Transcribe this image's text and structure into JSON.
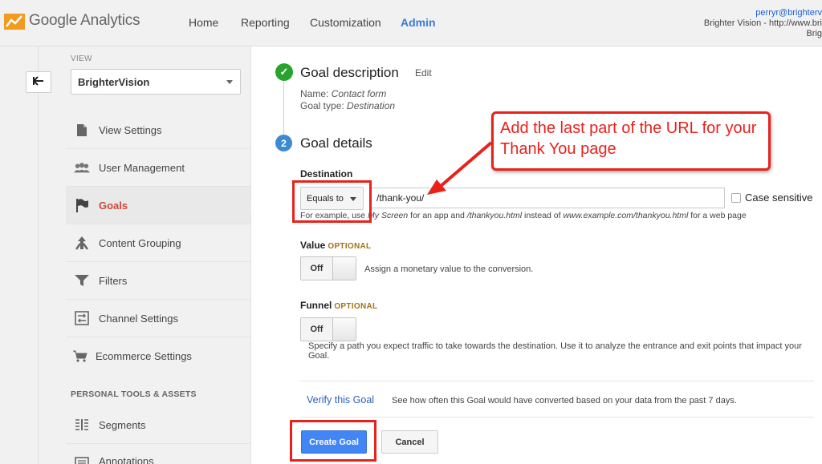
{
  "app": {
    "brand": "Google Analytics"
  },
  "nav": {
    "home": "Home",
    "reporting": "Reporting",
    "customization": "Customization",
    "admin": "Admin"
  },
  "user": {
    "email": "perryr@brighterv",
    "site": "Brighter Vision - http://www.bri",
    "site2": "Brig"
  },
  "sidebar": {
    "view_label": "VIEW",
    "view_name": "BrighterVision",
    "items": [
      {
        "label": "View Settings",
        "icon": "document-icon"
      },
      {
        "label": "User Management",
        "icon": "users-icon"
      },
      {
        "label": "Goals",
        "icon": "flag-icon"
      },
      {
        "label": "Content Grouping",
        "icon": "grouping-icon"
      },
      {
        "label": "Filters",
        "icon": "filter-icon"
      },
      {
        "label": "Channel Settings",
        "icon": "channel-icon"
      },
      {
        "label": "Ecommerce Settings",
        "icon": "cart-icon"
      }
    ],
    "section_title": "PERSONAL TOOLS & ASSETS",
    "items2": [
      {
        "label": "Segments",
        "icon": "segments-icon"
      },
      {
        "label": "Annotations",
        "icon": "annotations-icon"
      }
    ]
  },
  "goal_description": {
    "title": "Goal description",
    "edit": "Edit",
    "name_label": "Name: ",
    "name_value": "Contact form",
    "type_label": "Goal type: ",
    "type_value": "Destination"
  },
  "goal_details": {
    "step": "2",
    "title": "Goal details",
    "destination_label": "Destination",
    "match_type": "Equals to",
    "url_value": "/thank-you/",
    "case_sensitive": "Case sensitive",
    "hint_prefix": "For example, use ",
    "hint_app": "My Screen",
    "hint_mid": " for an app and ",
    "hint_url1": "/thankyou.html",
    "hint_mid2": " instead of ",
    "hint_url2": "www.example.com/thankyou.html",
    "hint_suffix": " for a web page",
    "value_label": "Value",
    "optional": "OPTIONAL",
    "value_toggle": "Off",
    "value_desc": "Assign a monetary value to the conversion.",
    "funnel_label": "Funnel",
    "funnel_toggle": "Off",
    "funnel_desc": "Specify a path you expect traffic to take towards the destination. Use it to analyze the entrance and exit points that impact your Goal."
  },
  "verify": {
    "link": "Verify this Goal",
    "desc": "See how often this Goal would have converted based on your data from the past 7 days."
  },
  "actions": {
    "create": "Create Goal",
    "cancel": "Cancel"
  },
  "annotation": {
    "callout": "Add the last part of the URL for your Thank You page",
    "color": "#e8221b"
  }
}
